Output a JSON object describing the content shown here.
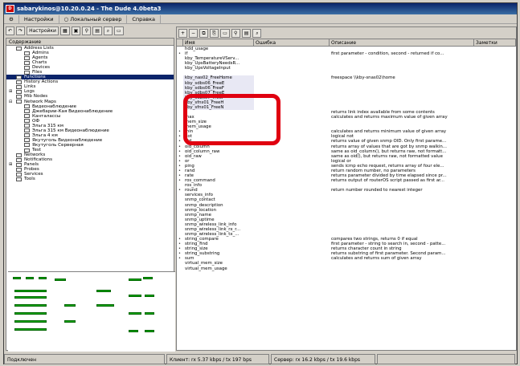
{
  "window": {
    "title": "sabarykinos@10.20.0.24 - The Dude 4.0beta3",
    "app_icon": "The Dude logo"
  },
  "menu": [
    "Настройки",
    "Локальный сервер",
    "Справка"
  ],
  "toolbar": {
    "settings_label": "Настройки"
  },
  "tree": {
    "header": "Содержание",
    "items": [
      {
        "label": "Address Lists",
        "level": 1
      },
      {
        "label": "Admins",
        "level": 2
      },
      {
        "label": "Agents",
        "level": 2
      },
      {
        "label": "Charts",
        "level": 2
      },
      {
        "label": "Devices",
        "level": 2
      },
      {
        "label": "Files",
        "level": 2
      },
      {
        "label": "Functions",
        "level": 1,
        "selected": true
      },
      {
        "label": "History Actions",
        "level": 1
      },
      {
        "label": "Links",
        "level": 1
      },
      {
        "label": "Logs",
        "level": 1,
        "expander": "⊞"
      },
      {
        "label": "Mib Nodes",
        "level": 1
      },
      {
        "label": "Network Maps",
        "level": 1,
        "expander": "⊟"
      },
      {
        "label": "Видеонаблюдение",
        "level": 2
      },
      {
        "label": "Джебарии-Кая Видеонаблюдение",
        "level": 2
      },
      {
        "label": "Канталассы",
        "level": 2
      },
      {
        "label": "ОФ",
        "level": 2
      },
      {
        "label": "Эльга 315 км",
        "level": 2
      },
      {
        "label": "Эльга 315 км Видеонаблюдение",
        "level": 2
      },
      {
        "label": "Эльга 4 км",
        "level": 2
      },
      {
        "label": "Якутуголь Видеонаблюдение",
        "level": 2
      },
      {
        "label": "Якутуголь Серверная",
        "level": 2
      },
      {
        "label": "Test",
        "level": 2
      },
      {
        "label": "Networks",
        "level": 1
      },
      {
        "label": "Notifications",
        "level": 1
      },
      {
        "label": "Panels",
        "level": 1,
        "expander": "⊞"
      },
      {
        "label": "Probes",
        "level": 1
      },
      {
        "label": "Services",
        "level": 1
      },
      {
        "label": "Tools",
        "level": 1
      }
    ]
  },
  "table": {
    "columns": [
      "Имя",
      "Ошибка",
      "Описание",
      "Заметки"
    ],
    "rows": [
      {
        "m": "",
        "name": "hdd_usage",
        "desc": ""
      },
      {
        "m": "•",
        "name": "if",
        "desc": "first parameter - condition, second - returned if co..."
      },
      {
        "m": "",
        "name": "kby_TemperatureVServ...",
        "desc": ""
      },
      {
        "m": "",
        "name": "kby_UpsBatteryNeedsR...",
        "desc": ""
      },
      {
        "m": "",
        "name": "kby_UpsVoltageInput",
        "desc": ""
      },
      {
        "m": "",
        "name": "",
        "desc": ""
      },
      {
        "m": "",
        "name": "kby_nas02_FreeHome",
        "desc": "freespace \\\\kby-snas02\\home"
      },
      {
        "m": "",
        "name": "kby_sdbs06_FreeE",
        "desc": ""
      },
      {
        "m": "",
        "name": "kby_sdbs06_FreeF",
        "desc": ""
      },
      {
        "m": "",
        "name": "kby_sdbs07_FreeE",
        "desc": ""
      },
      {
        "m": "",
        "name": "kby_sdbs07_FreeF",
        "desc": ""
      },
      {
        "m": "",
        "name": "kby_sfns01_FreeH",
        "desc": ""
      },
      {
        "m": "",
        "name": "kby_sfns01_FreeN",
        "desc": ""
      },
      {
        "m": "",
        "name": "",
        "desc": "returns link index available from some contents"
      },
      {
        "m": "",
        "name": "max",
        "desc": "calculates and returns maximum value of given array"
      },
      {
        "m": "",
        "name": "mem_size",
        "desc": ""
      },
      {
        "m": "",
        "name": "mem_usage",
        "desc": ""
      },
      {
        "m": "•",
        "name": "min",
        "desc": "calculates and returns minimum value of given array"
      },
      {
        "m": "•",
        "name": "not",
        "desc": "logical not"
      },
      {
        "m": "•",
        "name": "oid",
        "desc": "returns value of given snmp OID. Only first parame..."
      },
      {
        "m": "•",
        "name": "oid_column",
        "desc": "returns array of values that are got by snmp walkin..."
      },
      {
        "m": "•",
        "name": "oid_column_raw",
        "desc": "same as oid_column(), but returns raw, not formatt..."
      },
      {
        "m": "•",
        "name": "oid_raw",
        "desc": "same as oid(), but returns raw, not formatted value"
      },
      {
        "m": "•",
        "name": "or",
        "desc": "logical or"
      },
      {
        "m": "•",
        "name": "ping",
        "desc": "sends icmp echo request, returns array of four ele..."
      },
      {
        "m": "•",
        "name": "rand",
        "desc": "return random number, no parameters"
      },
      {
        "m": "•",
        "name": "rate",
        "desc": "returns parameter divided by time elapsed since pr..."
      },
      {
        "m": "•",
        "name": "ros_command",
        "desc": "returns output of routerOS script passed as first ar..."
      },
      {
        "m": "",
        "name": "ros_info",
        "desc": ""
      },
      {
        "m": "•",
        "name": "round",
        "desc": "return number rounded to nearest integer"
      },
      {
        "m": "",
        "name": "services_info",
        "desc": ""
      },
      {
        "m": "",
        "name": "snmp_contact",
        "desc": ""
      },
      {
        "m": "",
        "name": "snmp_description",
        "desc": ""
      },
      {
        "m": "",
        "name": "snmp_location",
        "desc": ""
      },
      {
        "m": "",
        "name": "snmp_name",
        "desc": ""
      },
      {
        "m": "",
        "name": "snmp_uptime",
        "desc": ""
      },
      {
        "m": "",
        "name": "snmp_wireless_link_info",
        "desc": ""
      },
      {
        "m": "",
        "name": "snmp_wireless_link_rx_r...",
        "desc": ""
      },
      {
        "m": "",
        "name": "snmp_wireless_link_tx_...",
        "desc": ""
      },
      {
        "m": "•",
        "name": "string_compare",
        "desc": "compares two strings, returns 0 if equal"
      },
      {
        "m": "•",
        "name": "string_find",
        "desc": "first parameter - string to search in, second - patte..."
      },
      {
        "m": "•",
        "name": "string_size",
        "desc": "returns character count in string"
      },
      {
        "m": "•",
        "name": "string_substring",
        "desc": "returns substring of first parameter. Second param..."
      },
      {
        "m": "•",
        "name": "sum",
        "desc": "calculates and returns sum of given array"
      },
      {
        "m": "",
        "name": "virtual_mem_size",
        "desc": ""
      },
      {
        "m": "",
        "name": "virtual_mem_usage",
        "desc": ""
      }
    ]
  },
  "status": {
    "connection": "Подключен",
    "client": "Клиент: rx 5.37 kbps / tx 197 bps",
    "server": "Сервер: rx 16.2 kbps / tx 19.6 kbps"
  },
  "colors": {
    "callout": "#e00010",
    "selection": "#0a246a",
    "node": "#00aa00"
  }
}
